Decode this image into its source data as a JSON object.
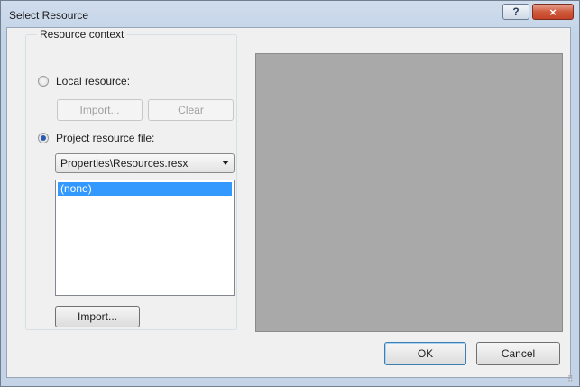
{
  "window": {
    "title": "Select Resource"
  },
  "caption": {
    "help": "?",
    "close": "×"
  },
  "resource_context": {
    "label": "Resource context",
    "local_resource": {
      "label": "Local resource:",
      "checked": false
    },
    "local_import_label": "Import...",
    "local_clear_label": "Clear",
    "project_resource": {
      "label": "Project resource file:",
      "checked": true
    },
    "project_file_selected": "Properties\\Resources.resx",
    "resources": [
      {
        "label": "(none)",
        "selected": true
      }
    ],
    "project_import_label": "Import..."
  },
  "footer": {
    "ok_label": "OK",
    "cancel_label": "Cancel"
  },
  "colors": {
    "selection": "#3399ff",
    "preview_bg": "#a9a9a9"
  }
}
